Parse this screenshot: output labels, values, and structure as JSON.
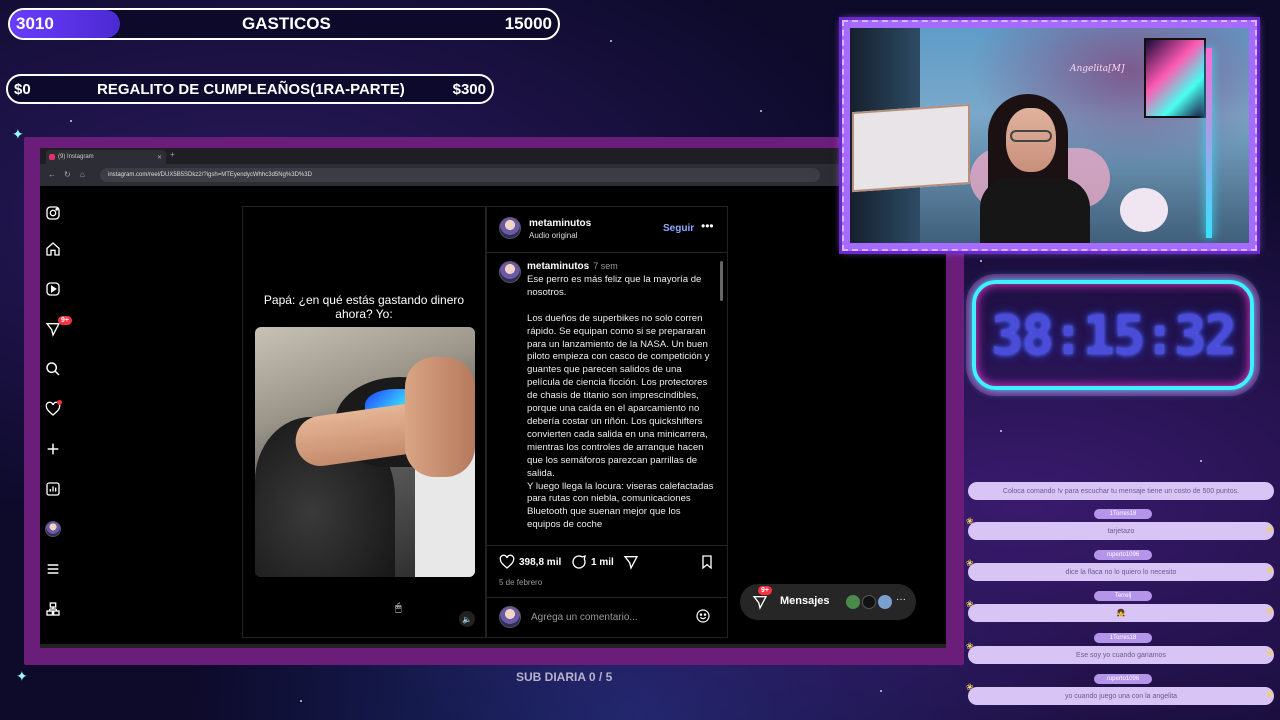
{
  "goals": {
    "gasticos": {
      "current": "3010",
      "title": "GASTICOS",
      "target": "15000",
      "progress": 0.2,
      "fill_color": "#6a3cff"
    },
    "regalito": {
      "current": "$0",
      "title": "REGALITO DE CUMPLEAÑOS(1RA-PARTE)",
      "target": "$300",
      "progress": 0.0
    }
  },
  "browser": {
    "tab_title": "(9) Instagram",
    "url": "instagram.com/reel/DUX5B5SDkz2/?igsh=MTEyendycWhhc3d5Ng%3D%3D"
  },
  "sidebar_icons": [
    "instagram-icon",
    "home-icon",
    "reels-icon",
    "messages-icon",
    "search-icon",
    "heart-icon",
    "create-icon",
    "dashboard-icon",
    "profile-avatar",
    "menu-icon",
    "more-apps-icon"
  ],
  "sidebar": {
    "messages_badge": "9+"
  },
  "reel": {
    "caption": "Papá: ¿en qué estás gastando dinero ahora? Yo:"
  },
  "post": {
    "username": "metaminutos",
    "subtitle": "Audio original",
    "follow_label": "Seguir",
    "comment_user": "metaminutos",
    "comment_time": "7 sem",
    "comment_text": "Ese perro es más feliz que la mayoría de nosotros.\n\nLos dueños de superbikes no solo corren rápido. Se equipan como si se prepararan para un lanzamiento de la NASA. Un buen piloto empieza con casco de competición y guantes que parecen salidos de una película de ciencia ficción. Los protectores de chasis de titanio son imprescindibles, porque una caída en el aparcamiento no debería costar un riñón. Los quickshifters convierten cada salida en una minicarrera, mientras los controles de arranque hacen que los semáforos parezcan parrillas de salida.\nY luego llega la locura: viseras calefactadas para rutas con niebla, comunicaciones Bluetooth que suenan mejor que los equipos de coche",
    "likes": "398,8 mil",
    "comments": "1 mil",
    "date": "5 de febrero",
    "comment_placeholder": "Agrega un comentario..."
  },
  "messages_pill": {
    "label": "Mensajes",
    "badge": "9+"
  },
  "webcam": {
    "sign_text": "Angelita[M]"
  },
  "timer": {
    "value": "38:15:32",
    "color": "#4b4cd9"
  },
  "chat": [
    {
      "name": "",
      "text": "Coloca comando !v para escuchar tu mensaje tiene un costo de 500 puntos."
    },
    {
      "name": "1Torres18",
      "text": "tarjetazo"
    },
    {
      "name": "ruperto1096",
      "text": "dice la flaca no lo quiero lo necesito"
    },
    {
      "name": "Terrelj",
      "text": "👧"
    },
    {
      "name": "1Torres18",
      "text": "Ese soy yo cuando ganamos"
    },
    {
      "name": "ruperto1096",
      "text": "yo cuando juego una con la angelita"
    }
  ],
  "sub_goal": "SUB DIARIA 0 / 5"
}
